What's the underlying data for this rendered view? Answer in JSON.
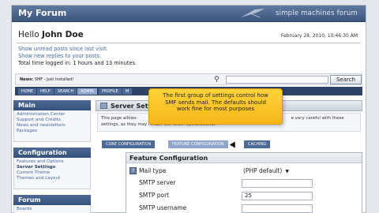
{
  "header": {
    "forum_title": "My Forum",
    "brand": "simple machines forum",
    "greeting": "Hello ",
    "user": "John Doe",
    "datetime": "February 28, 2010, 10:46:30 AM"
  },
  "user_links": {
    "unread": "Show unread posts since last visit.",
    "replies": "Show new replies to your posts.",
    "time_logged": "Total time logged in: 1 hours and 13 minutes."
  },
  "news": {
    "label": "News:",
    "text": "SMF - Just Installed!"
  },
  "search": {
    "button_label": "Search",
    "value": ""
  },
  "menu": {
    "items": [
      {
        "label": "HOME"
      },
      {
        "label": "HELP"
      },
      {
        "label": "SEARCH"
      },
      {
        "label": "ADMIN"
      },
      {
        "label": "PROFILE"
      },
      {
        "label": "M"
      }
    ]
  },
  "sidebar": {
    "sections": [
      {
        "title": "Main",
        "items": [
          "Administration Center",
          "Support and Credits",
          "News and newsletters",
          "Packages"
        ]
      },
      {
        "title": "Configuration",
        "items": [
          "Features and Options",
          "Server Settings",
          "Current Theme",
          "Themes and Layout"
        ]
      },
      {
        "title": "Forum",
        "items": [
          "Boards"
        ]
      }
    ]
  },
  "panel": {
    "title": "Server Setti",
    "desc_line1": "This page allows",
    "desc_line1_end": "e very careful with these",
    "desc_line2": "settings, as they may render the forum dysfunctional.",
    "tabs": [
      "CORE CONFIGURATION",
      "FEATURE CONFIGURATION",
      "CACHING"
    ]
  },
  "feature": {
    "title": "Feature Configuration",
    "rows": [
      {
        "label": "Mail type",
        "value": "(PHP default)"
      },
      {
        "label": "SMTP server",
        "value": ""
      },
      {
        "label": "SMTP port",
        "value": "25"
      },
      {
        "label": "SMTP username",
        "value": ""
      }
    ]
  },
  "tooltip": {
    "lines": [
      "The first group of settings control how",
      "SMF sends mail. The defaults should",
      "work fine for most purposes"
    ]
  },
  "colors": {
    "accent": "#3c5580",
    "link": "#4868a2",
    "tooltip": "#f7b718"
  }
}
